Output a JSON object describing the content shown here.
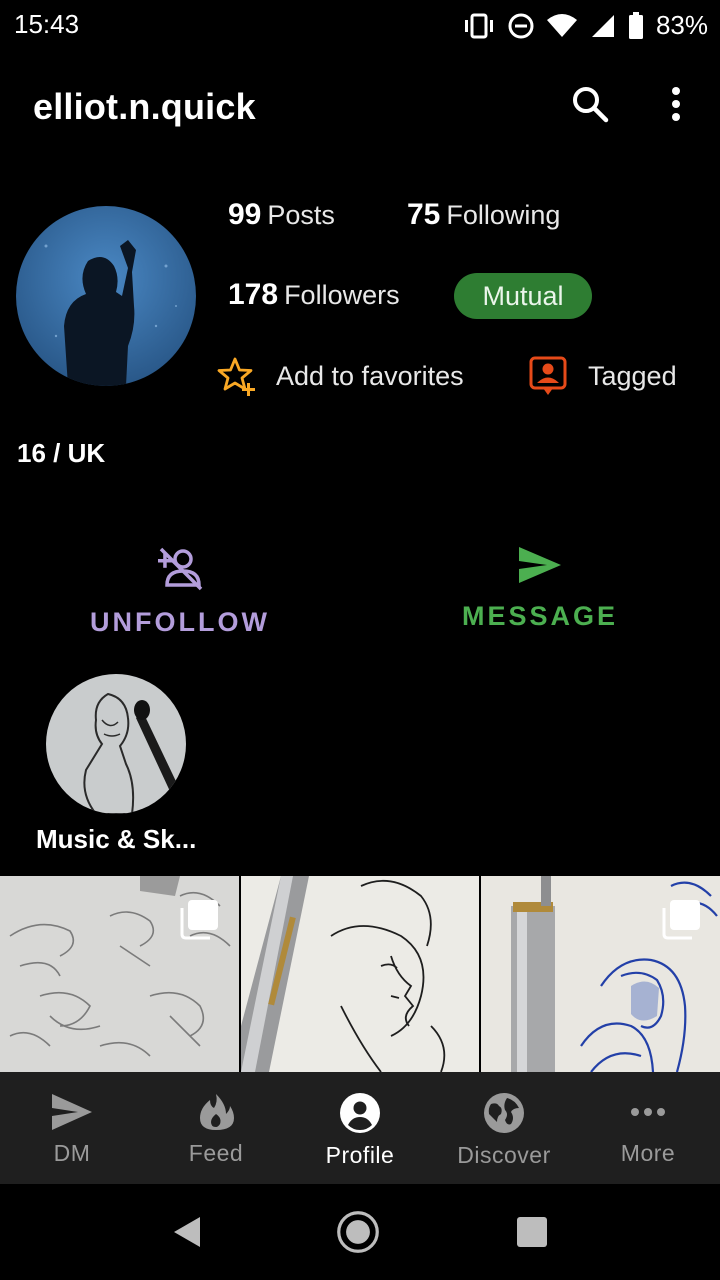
{
  "status_bar": {
    "time": "15:43",
    "battery": "83%",
    "icons": [
      "vibrate-icon",
      "dnd-icon",
      "wifi-icon",
      "signal-icon",
      "battery-icon"
    ]
  },
  "header": {
    "username": "elliot.n.quick",
    "icons": [
      "search-icon",
      "more-vert-icon"
    ]
  },
  "profile": {
    "posts_count": "99",
    "posts_label": "Posts",
    "following_count": "75",
    "following_label": "Following",
    "followers_count": "178",
    "followers_label": "Followers",
    "mutual_badge": "Mutual",
    "favorites_label": "Add to favorites",
    "tagged_label": "Tagged",
    "bio": "16 / UK"
  },
  "actions": {
    "unfollow_label": "UNFOLLOW",
    "message_label": "MESSAGE"
  },
  "highlights": [
    {
      "label": "Music & Sk..."
    }
  ],
  "bottom_nav": [
    {
      "label": "DM",
      "icon": "send-icon"
    },
    {
      "label": "Feed",
      "icon": "flame-icon"
    },
    {
      "label": "Profile",
      "icon": "account-circle-icon",
      "active": true
    },
    {
      "label": "Discover",
      "icon": "globe-icon"
    },
    {
      "label": "More",
      "icon": "more-horiz-icon"
    }
  ],
  "colors": {
    "accent_green": "#2e7d32",
    "message_green": "#4caf50",
    "unfollow_purple": "#b39ddb",
    "favorite_orange": "#f9a825",
    "tagged_red": "#e64a19"
  }
}
